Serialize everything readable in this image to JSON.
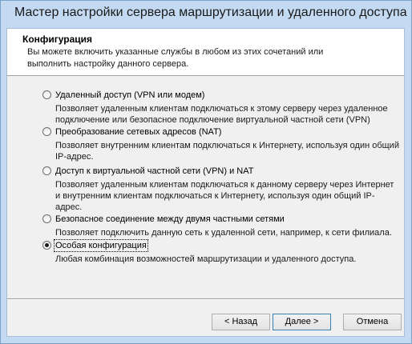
{
  "window": {
    "title": "Мастер настройки сервера маршрутизации и удаленного доступа"
  },
  "header": {
    "title": "Конфигурация",
    "description": "Вы можете включить указанные службы в любом из этих сочетаний или выполнить настройку данного сервера."
  },
  "options": [
    {
      "label": "Удаленный доступ (VPN или модем)",
      "description": "Позволяет удаленным клиентам подключаться к этому серверу через удаленное подключение или безопасное подключение виртуальной частной сети (VPN)",
      "selected": false
    },
    {
      "label": "Преобразование сетевых адресов (NAT)",
      "description": "Позволяет внутренним клиентам подключаться к Интернету, используя один общий IP-адрес.",
      "selected": false
    },
    {
      "label": "Доступ к виртуальной частной сети (VPN) и NAT",
      "description": "Позволяет удаленным клиентам подключаться к данному серверу через Интернет и внутренним клиентам подключаться к Интернету, используя один общий IP-адрес.",
      "selected": false
    },
    {
      "label": "Безопасное соединение между двумя частными сетями",
      "description": "Позволяет подключить данную сеть к удаленной сети, например, к сети филиала.",
      "selected": false
    },
    {
      "label": "Особая конфигурация",
      "description": "Любая комбинация возможностей маршрутизации и удаленного доступа.",
      "selected": true
    }
  ],
  "buttons": {
    "back": "< Назад",
    "next": "Далее >",
    "cancel": "Отмена"
  }
}
